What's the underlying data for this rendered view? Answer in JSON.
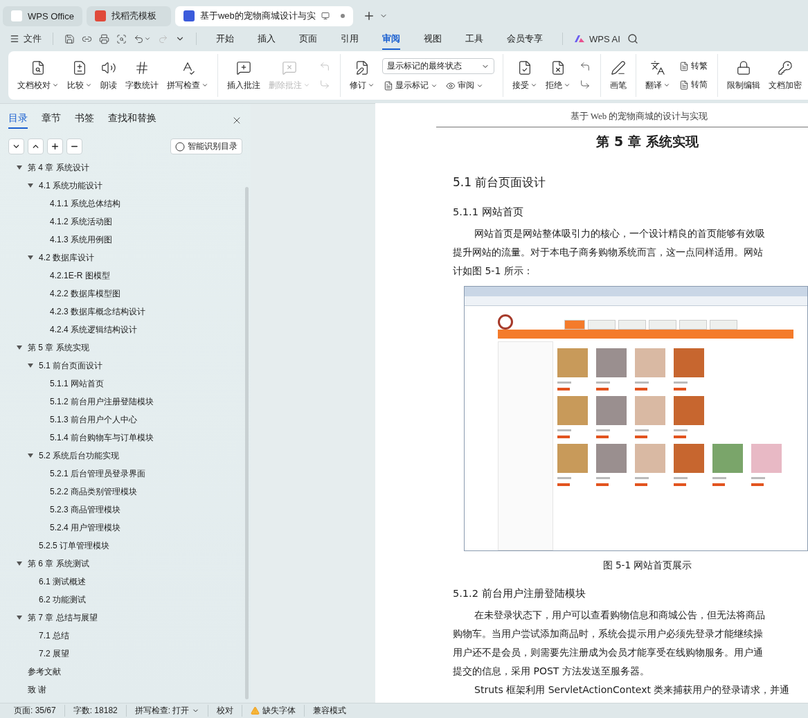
{
  "app_tabs": [
    {
      "kind": "home",
      "label": "WPS Office",
      "selected": false
    },
    {
      "kind": "template",
      "label": "找稻壳模板",
      "selected": false
    },
    {
      "kind": "document",
      "label": "基于web的宠物商城设计与实",
      "selected": true
    }
  ],
  "toolbar": {
    "file_menu": "文件",
    "ai_label": "WPS AI"
  },
  "menu_tabs": [
    {
      "label": "开始",
      "selected": false
    },
    {
      "label": "插入",
      "selected": false
    },
    {
      "label": "页面",
      "selected": false
    },
    {
      "label": "引用",
      "selected": false
    },
    {
      "label": "审阅",
      "selected": true
    },
    {
      "label": "视图",
      "selected": false
    },
    {
      "label": "工具",
      "selected": false
    },
    {
      "label": "会员专享",
      "selected": false
    }
  ],
  "ribbon": [
    {
      "items": [
        {
          "kind": "large",
          "label": "文档校对",
          "dropdown": true,
          "disabled": false
        },
        {
          "kind": "large",
          "label": "比较",
          "dropdown": true,
          "disabled": false
        },
        {
          "kind": "large",
          "label": "朗读",
          "dropdown": false,
          "disabled": false
        },
        {
          "kind": "large",
          "label": "字数统计",
          "dropdown": false,
          "disabled": false
        },
        {
          "kind": "large",
          "label": "拼写检查",
          "dropdown": true,
          "disabled": false
        }
      ]
    },
    {
      "items": [
        {
          "kind": "large",
          "label": "插入批注",
          "dropdown": false,
          "disabled": false
        },
        {
          "kind": "large",
          "label": "删除批注",
          "dropdown": true,
          "disabled": true
        },
        {
          "kind": "stack",
          "rows": [
            [
              {
                "kind": "icon",
                "disabled": true
              }
            ],
            [
              {
                "kind": "icon",
                "disabled": true
              }
            ]
          ]
        }
      ]
    },
    {
      "items": [
        {
          "kind": "large",
          "label": "修订",
          "dropdown": true,
          "disabled": false
        },
        {
          "kind": "stack",
          "rows": [
            [
              {
                "kind": "select",
                "value": "显示标记的最终状态"
              }
            ],
            [
              {
                "kind": "small",
                "label": "显示标记",
                "dropdown": true
              },
              {
                "kind": "small",
                "label": "审阅",
                "dropdown": true
              }
            ]
          ]
        }
      ]
    },
    {
      "items": [
        {
          "kind": "large",
          "label": "接受",
          "dropdown": true,
          "disabled": false
        },
        {
          "kind": "large",
          "label": "拒绝",
          "dropdown": true,
          "disabled": false
        },
        {
          "kind": "stack",
          "rows": [
            [
              {
                "kind": "icon",
                "disabled": false
              }
            ],
            [
              {
                "kind": "icon",
                "disabled": false
              }
            ]
          ]
        }
      ]
    },
    {
      "items": [
        {
          "kind": "large",
          "label": "画笔",
          "dropdown": false,
          "disabled": false
        }
      ]
    },
    {
      "items": [
        {
          "kind": "large",
          "label": "翻译",
          "dropdown": true,
          "disabled": false
        },
        {
          "kind": "stack",
          "rows": [
            [
              {
                "kind": "small",
                "label": "转繁",
                "dropdown": false
              }
            ],
            [
              {
                "kind": "small",
                "label": "转简",
                "dropdown": false
              }
            ]
          ]
        }
      ]
    },
    {
      "items": [
        {
          "kind": "large",
          "label": "限制编辑",
          "dropdown": false,
          "disabled": false
        },
        {
          "kind": "large",
          "label": "文档加密",
          "dropdown": false,
          "disabled": false
        }
      ]
    }
  ],
  "nav_panel": {
    "tabs": [
      {
        "label": "目录",
        "selected": true
      },
      {
        "label": "章节",
        "selected": false
      },
      {
        "label": "书签",
        "selected": false
      },
      {
        "label": "查找和替换",
        "selected": false
      }
    ],
    "smart_button": "智能识别目录",
    "toc": [
      {
        "label": "第 4 章  系统设计",
        "expanded": true,
        "children": [
          {
            "label": "4.1  系统功能设计",
            "expanded": true,
            "children": [
              {
                "label": "4.1.1 系统总体结构"
              },
              {
                "label": "4.1.2 系统活动图"
              },
              {
                "label": "4.1.3 系统用例图"
              }
            ]
          },
          {
            "label": "4.2 数据库设计",
            "expanded": true,
            "children": [
              {
                "label": "4.2.1E-R 图模型"
              },
              {
                "label": "4.2.2 数据库模型图"
              },
              {
                "label": "4.2.3 数据库概念结构设计"
              },
              {
                "label": "4.2.4 系统逻辑结构设计"
              }
            ]
          }
        ]
      },
      {
        "label": "第 5 章  系统实现",
        "expanded": true,
        "children": [
          {
            "label": "5.1 前台页面设计",
            "expanded": true,
            "children": [
              {
                "label": "5.1.1 网站首页"
              },
              {
                "label": "5.1.2 前台用户注册登陆模块"
              },
              {
                "label": "5.1.3 前台用户个人中心"
              },
              {
                "label": "5.1.4 前台购物车与订单模块"
              }
            ]
          },
          {
            "label": "5.2 系统后台功能实现",
            "expanded": true,
            "children": [
              {
                "label": "5.2.1 后台管理员登录界面"
              },
              {
                "label": "5.2.2 商品类别管理模块"
              },
              {
                "label": "5.2.3 商品管理模块"
              },
              {
                "label": "5.2.4 用户管理模块"
              }
            ]
          },
          {
            "label": "5.2.5 订单管理模块"
          }
        ]
      },
      {
        "label": "第 6 章  系统测试",
        "expanded": true,
        "children": [
          {
            "label": "6.1 测试概述"
          },
          {
            "label": "6.2 功能测试"
          }
        ]
      },
      {
        "label": "第 7 章  总结与展望",
        "expanded": true,
        "children": [
          {
            "label": "7.1 总结"
          },
          {
            "label": "7.2 展望"
          }
        ]
      },
      {
        "label": "参考文献"
      },
      {
        "label": "致  谢"
      }
    ]
  },
  "document": {
    "header": "基于 Web 的宠物商城的设计与实现",
    "chapter_title": "第 5 章  系统实现",
    "section_title": "5.1 前台页面设计",
    "blocks": [
      {
        "kind": "subheading",
        "text": "5.1.1 网站首页"
      },
      {
        "kind": "line",
        "indent": true,
        "text": "网站首页是网站整体吸引力的核心，一个设计精良的首页能够有效吸"
      },
      {
        "kind": "line",
        "indent": false,
        "text": "提升网站的流量。对于本电子商务购物系统而言，这一点同样适用。网站"
      },
      {
        "kind": "line",
        "indent": false,
        "text": "计如图 5-1 所示："
      },
      {
        "kind": "figure"
      },
      {
        "kind": "caption",
        "text": "图 5-1  网站首页展示"
      },
      {
        "kind": "subheading",
        "text": "5.1.2 前台用户注册登陆模块"
      },
      {
        "kind": "line",
        "indent": true,
        "text": "在未登录状态下，用户可以查看购物信息和商城公告，但无法将商品"
      },
      {
        "kind": "line",
        "indent": false,
        "text": "购物车。当用户尝试添加商品时，系统会提示用户必须先登录才能继续操"
      },
      {
        "kind": "line",
        "indent": false,
        "text": "用户还不是会员，则需要先注册成为会员才能享受在线购物服务。用户通"
      },
      {
        "kind": "line",
        "indent": false,
        "text": "提交的信息，采用 POST 方法发送至服务器。"
      },
      {
        "kind": "line",
        "indent": true,
        "text": "Struts 框架利用 ServletActionContext 类来捕获用户的登录请求，并通"
      }
    ]
  },
  "status_bar": [
    {
      "kind": "text",
      "text": "页面: 35/67"
    },
    {
      "kind": "text",
      "text": "字数: 18182"
    },
    {
      "kind": "dropdown",
      "text": "拼写检查: 打开"
    },
    {
      "kind": "text",
      "text": "校对"
    },
    {
      "kind": "warning",
      "text": "缺失字体"
    },
    {
      "kind": "text",
      "text": "兼容模式"
    }
  ]
}
